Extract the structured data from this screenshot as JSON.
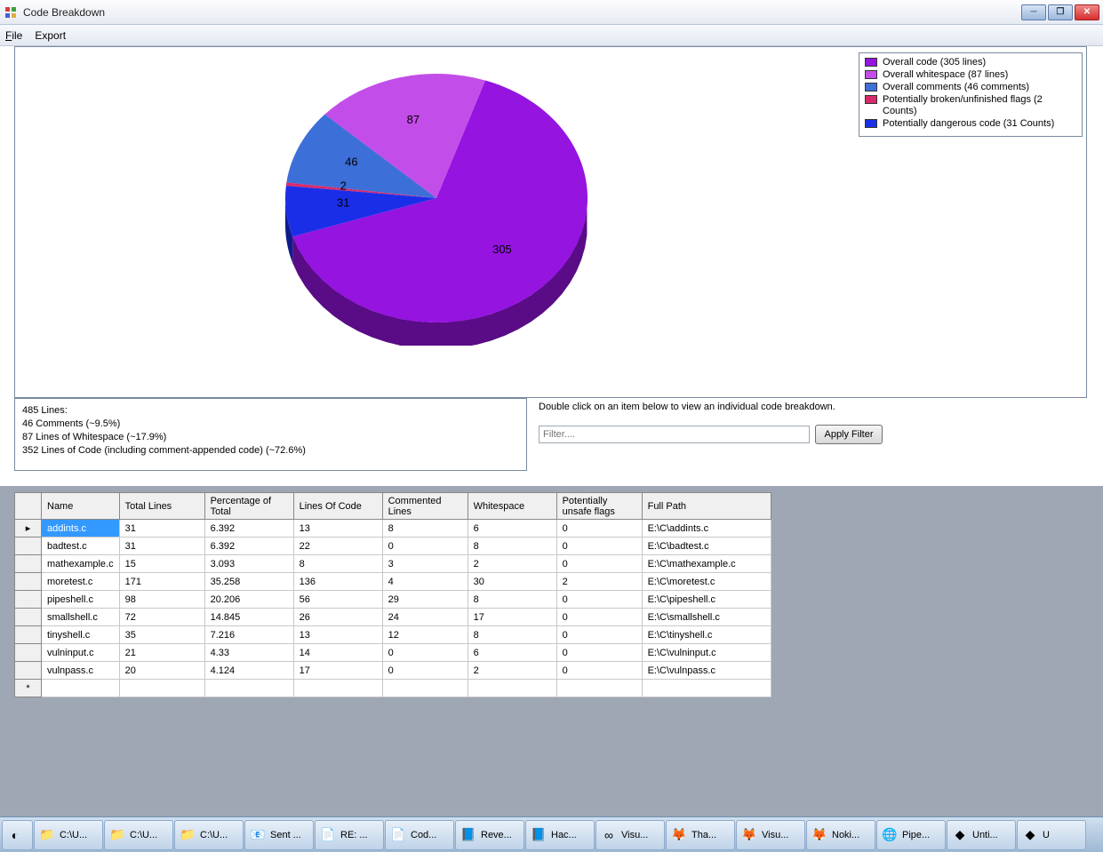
{
  "window": {
    "title": "Code Breakdown"
  },
  "menu": {
    "file": "File",
    "export": "Export"
  },
  "chart_data": {
    "type": "pie",
    "title": "",
    "slices": [
      {
        "label": "Overall code (305 lines)",
        "value": 305,
        "color": "#9514e0"
      },
      {
        "label": "Overall whitespace (87 lines)",
        "value": 87,
        "color": "#c34de8"
      },
      {
        "label": "Overall comments (46 comments)",
        "value": 46,
        "color": "#3d6fd8"
      },
      {
        "label": "Potentially broken/unfinished flags (2 Counts)",
        "value": 2,
        "color": "#d82a6a"
      },
      {
        "label": "Potentially dangerous code (31 Counts)",
        "value": 31,
        "color": "#1a2ee8"
      }
    ]
  },
  "legend": {
    "items": [
      {
        "color": "#9514e0",
        "text": "Overall code (305 lines)"
      },
      {
        "color": "#c34de8",
        "text": "Overall whitespace (87 lines)"
      },
      {
        "color": "#3d6fd8",
        "text": "Overall comments (46 comments)"
      },
      {
        "color": "#d82a6a",
        "text": "Potentially broken/unfinished flags (2 Counts)"
      },
      {
        "color": "#1a2ee8",
        "text": "Potentially dangerous code (31 Counts)"
      }
    ]
  },
  "summary": {
    "l1": "485 Lines:",
    "l2": "46 Comments (~9.5%)",
    "l3": "87 Lines of Whitespace (~17.9%)",
    "l4": "352 Lines of Code (including comment-appended code) (~72.6%)"
  },
  "filter": {
    "instruction": "Double click on an item below to view an individual code breakdown.",
    "placeholder": "Filter....",
    "apply": "Apply Filter"
  },
  "table": {
    "headers": {
      "name": "Name",
      "total": "Total Lines",
      "pct": "Percentage of Total",
      "loc": "Lines Of Code",
      "comments": "Commented Lines",
      "ws": "Whitespace",
      "unsafe": "Potentially unsafe flags",
      "path": "Full Path"
    },
    "rows": [
      {
        "name": "addints.c",
        "total": "31",
        "pct": "6.392",
        "loc": "13",
        "comments": "8",
        "ws": "6",
        "unsafe": "0",
        "path": "E:\\C\\addints.c"
      },
      {
        "name": "badtest.c",
        "total": "31",
        "pct": "6.392",
        "loc": "22",
        "comments": "0",
        "ws": "8",
        "unsafe": "0",
        "path": "E:\\C\\badtest.c"
      },
      {
        "name": "mathexample.c",
        "total": "15",
        "pct": "3.093",
        "loc": "8",
        "comments": "3",
        "ws": "2",
        "unsafe": "0",
        "path": "E:\\C\\mathexample.c"
      },
      {
        "name": "moretest.c",
        "total": "171",
        "pct": "35.258",
        "loc": "136",
        "comments": "4",
        "ws": "30",
        "unsafe": "2",
        "path": "E:\\C\\moretest.c"
      },
      {
        "name": "pipeshell.c",
        "total": "98",
        "pct": "20.206",
        "loc": "56",
        "comments": "29",
        "ws": "8",
        "unsafe": "0",
        "path": "E:\\C\\pipeshell.c"
      },
      {
        "name": "smallshell.c",
        "total": "72",
        "pct": "14.845",
        "loc": "26",
        "comments": "24",
        "ws": "17",
        "unsafe": "0",
        "path": "E:\\C\\smallshell.c"
      },
      {
        "name": "tinyshell.c",
        "total": "35",
        "pct": "7.216",
        "loc": "13",
        "comments": "12",
        "ws": "8",
        "unsafe": "0",
        "path": "E:\\C\\tinyshell.c"
      },
      {
        "name": "vulninput.c",
        "total": "21",
        "pct": "4.33",
        "loc": "14",
        "comments": "0",
        "ws": "6",
        "unsafe": "0",
        "path": "E:\\C\\vulninput.c"
      },
      {
        "name": "vulnpass.c",
        "total": "20",
        "pct": "4.124",
        "loc": "17",
        "comments": "0",
        "ws": "2",
        "unsafe": "0",
        "path": "E:\\C\\vulnpass.c"
      }
    ]
  },
  "taskbar": {
    "items": [
      {
        "icon": "folder",
        "label": "C:\\U..."
      },
      {
        "icon": "folder",
        "label": "C:\\U..."
      },
      {
        "icon": "folder",
        "label": "C:\\U..."
      },
      {
        "icon": "outlook",
        "label": "Sent ..."
      },
      {
        "icon": "doc",
        "label": "RE: ..."
      },
      {
        "icon": "doc",
        "label": "Cod..."
      },
      {
        "icon": "word",
        "label": "Reve..."
      },
      {
        "icon": "word",
        "label": "Hac..."
      },
      {
        "icon": "vs",
        "label": "Visu..."
      },
      {
        "icon": "firefox",
        "label": "Tha..."
      },
      {
        "icon": "firefox",
        "label": "Visu..."
      },
      {
        "icon": "firefox",
        "label": "Noki..."
      },
      {
        "icon": "chrome",
        "label": "Pipe..."
      },
      {
        "icon": "app",
        "label": "Unti..."
      },
      {
        "icon": "app",
        "label": "U"
      }
    ]
  }
}
